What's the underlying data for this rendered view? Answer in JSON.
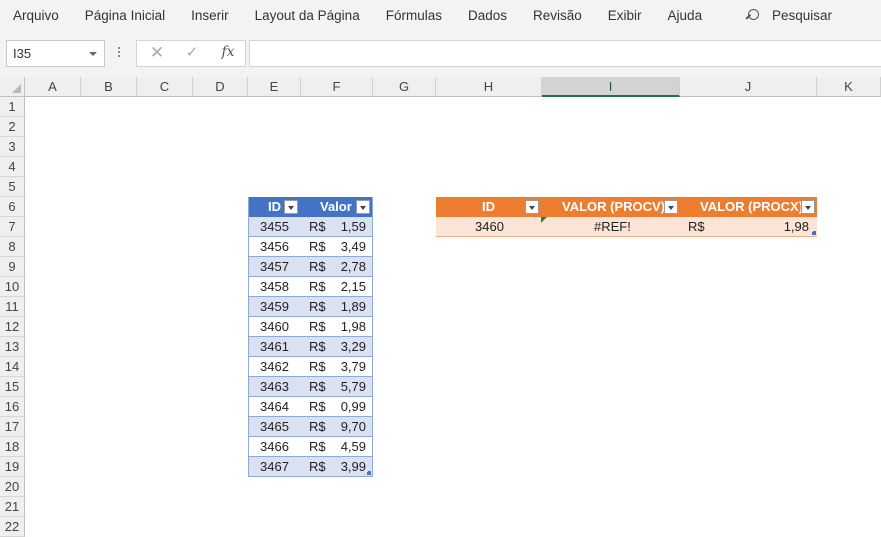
{
  "menu": [
    "Arquivo",
    "Página Inicial",
    "Inserir",
    "Layout da Página",
    "Fórmulas",
    "Dados",
    "Revisão",
    "Exibir",
    "Ajuda"
  ],
  "search": {
    "label": "Pesquisar",
    "icon": "search-icon"
  },
  "formula_bar": {
    "name_box": "I35",
    "cancel_icon": "✕",
    "enter_icon": "✓",
    "fx_label": "fx",
    "formula": ""
  },
  "columns": [
    "A",
    "B",
    "C",
    "D",
    "E",
    "F",
    "G",
    "H",
    "I",
    "J",
    "K"
  ],
  "selected_column": "I",
  "rows": [
    "1",
    "2",
    "3",
    "4",
    "5",
    "6",
    "7",
    "8",
    "9",
    "10",
    "11",
    "12",
    "13",
    "14",
    "15",
    "16",
    "17",
    "18",
    "19",
    "20",
    "21",
    "22"
  ],
  "price_table": {
    "header_id": "ID",
    "header_value": "Valor",
    "currency": "R$",
    "rows": [
      {
        "id": "3455",
        "value": "1,59"
      },
      {
        "id": "3456",
        "value": "3,49"
      },
      {
        "id": "3457",
        "value": "2,78"
      },
      {
        "id": "3458",
        "value": "2,15"
      },
      {
        "id": "3459",
        "value": "1,89"
      },
      {
        "id": "3460",
        "value": "1,98"
      },
      {
        "id": "3461",
        "value": "3,29"
      },
      {
        "id": "3462",
        "value": "3,79"
      },
      {
        "id": "3463",
        "value": "5,79"
      },
      {
        "id": "3464",
        "value": "0,99"
      },
      {
        "id": "3465",
        "value": "9,70"
      },
      {
        "id": "3466",
        "value": "4,59"
      },
      {
        "id": "3467",
        "value": "3,99"
      }
    ]
  },
  "lookup_table": {
    "header_id": "ID",
    "header_procv": "VALOR (PROCV)",
    "header_procx": "VALOR (PROCX)",
    "row": {
      "id": "3460",
      "procv": "#REF!",
      "currency": "R$",
      "procx": "1,98"
    }
  },
  "colors": {
    "blue_header": "#4472c4",
    "blue_band": "#d9e1f2",
    "orange_header": "#ed7d31",
    "orange_band": "#fce4d6",
    "selected_col_accent": "#217346"
  }
}
